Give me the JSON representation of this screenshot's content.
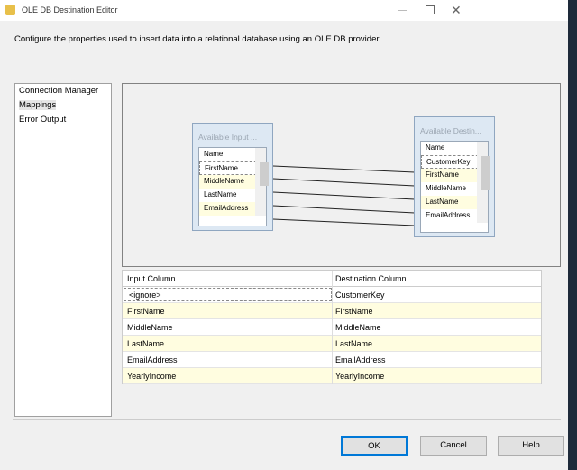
{
  "window": {
    "title": "OLE DB Destination Editor",
    "description": "Configure the properties used to insert data into a relational database using an OLE DB provider."
  },
  "nav": {
    "items": [
      {
        "label": "Connection Manager"
      },
      {
        "label": "Mappings",
        "selected": true
      },
      {
        "label": "Error Output"
      }
    ]
  },
  "diagram": {
    "input": {
      "title": "Available Input ...",
      "header": "Name",
      "items": [
        "FirstName",
        "MiddleName",
        "LastName",
        "EmailAddress"
      ]
    },
    "destination": {
      "title": "Available Destin...",
      "header": "Name",
      "items": [
        "CustomerKey",
        "FirstName",
        "MiddleName",
        "LastName",
        "EmailAddress"
      ]
    }
  },
  "grid": {
    "headers": [
      "Input Column",
      "Destination Column"
    ],
    "rows": [
      [
        "<ignore>",
        "CustomerKey"
      ],
      [
        "FirstName",
        "FirstName"
      ],
      [
        "MiddleName",
        "MiddleName"
      ],
      [
        "LastName",
        "LastName"
      ],
      [
        "EmailAddress",
        "EmailAddress"
      ],
      [
        "YearlyIncome",
        "YearlyIncome"
      ]
    ]
  },
  "buttons": {
    "ok": "OK",
    "cancel": "Cancel",
    "help": "Help"
  },
  "colors": {
    "highlight_row": "#fffde0",
    "ok_border": "#0078d7"
  }
}
